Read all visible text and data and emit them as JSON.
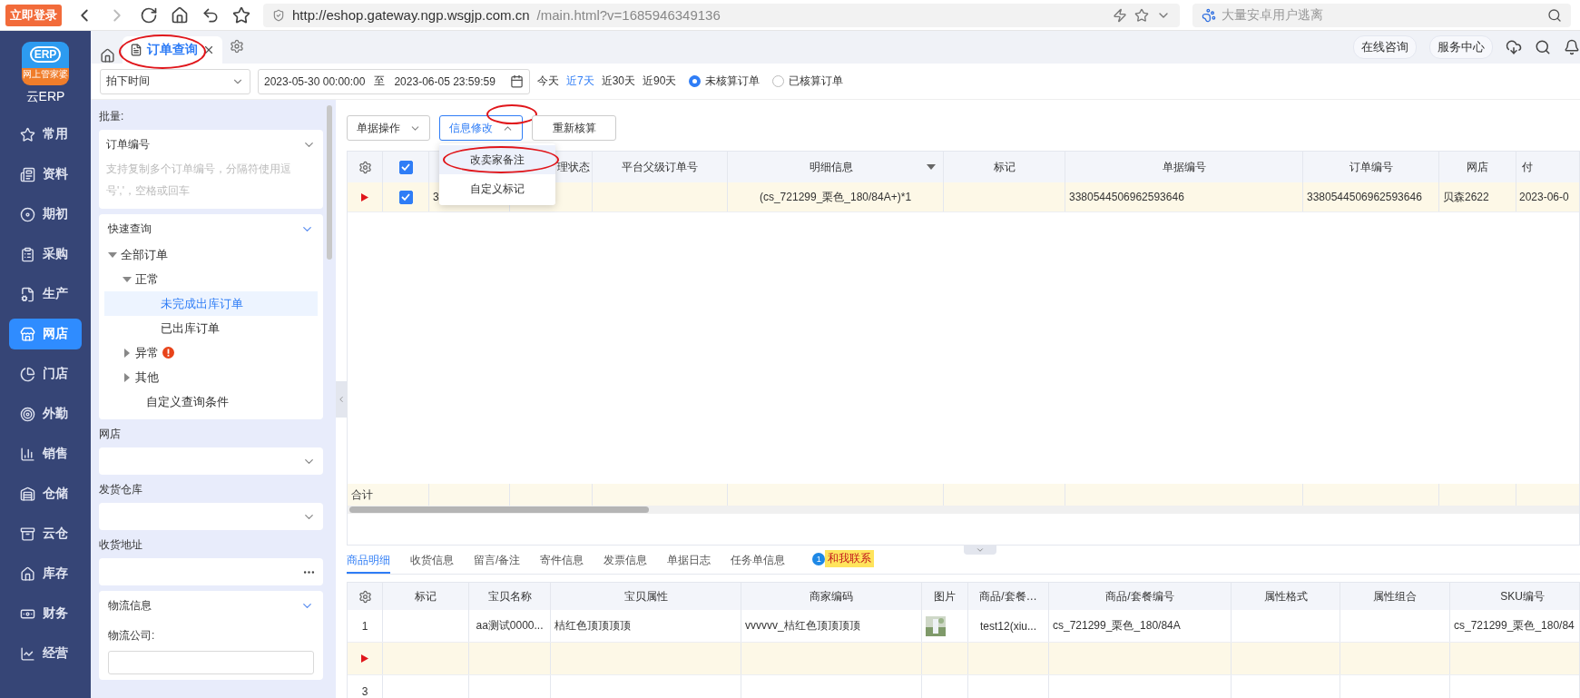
{
  "browser": {
    "login_button": "立即登录",
    "url_host": "http://eshop.gateway.ngp.wsgjp.com.cn",
    "url_path": "/main.html?v=1685946349136",
    "search_placeholder": "大量安卓用户逃离"
  },
  "nav": {
    "logo_mark": "ERP",
    "logo_badge": "网上管家婆",
    "logo_text": "云ERP",
    "items": [
      {
        "label": "常用",
        "selected": false
      },
      {
        "label": "资料",
        "selected": false
      },
      {
        "label": "期初",
        "selected": false
      },
      {
        "label": "采购",
        "selected": false
      },
      {
        "label": "生产",
        "selected": false
      },
      {
        "label": "网店",
        "selected": true
      },
      {
        "label": "门店",
        "selected": false
      },
      {
        "label": "外勤",
        "selected": false
      },
      {
        "label": "销售",
        "selected": false
      },
      {
        "label": "仓储",
        "selected": false
      },
      {
        "label": "云仓",
        "selected": false
      },
      {
        "label": "库存",
        "selected": false
      },
      {
        "label": "财务",
        "selected": false
      },
      {
        "label": "经营",
        "selected": false
      }
    ]
  },
  "tabs": [
    {
      "label": "订单查询",
      "selected": true,
      "circled": true
    }
  ],
  "header_links": [
    "在线咨询",
    "服务中心"
  ],
  "filters": {
    "time_field": "拍下时间",
    "date_from": "2023-05-30 00:00:00",
    "date_sep": "至",
    "date_to": "2023-06-05 23:59:59",
    "quick_ranges": [
      {
        "label": "今天",
        "selected": false
      },
      {
        "label": "近7天",
        "selected": true
      },
      {
        "label": "近30天",
        "selected": false
      },
      {
        "label": "近90天",
        "selected": false
      }
    ],
    "status_options": [
      {
        "label": "未核算订单",
        "selected": true
      },
      {
        "label": "已核算订单",
        "selected": false
      }
    ]
  },
  "side_panel": {
    "batch_label": "批量:",
    "batch_field": "订单编号",
    "batch_placeholder": "支持复制多个订单编号，分隔符使用逗号','，空格或回车",
    "quick_query": {
      "title": "快速查询",
      "tree": [
        {
          "label": "全部订单",
          "expanded": true,
          "selected": false,
          "alert": false,
          "children": [
            {
              "label": "正常",
              "expanded": true,
              "selected": false,
              "alert": false,
              "children": [
                {
                  "label": "未完成出库订单",
                  "selected": true,
                  "alert": false
                },
                {
                  "label": "已出库订单",
                  "selected": false,
                  "alert": false
                }
              ]
            },
            {
              "label": "异常",
              "expanded": false,
              "selected": false,
              "alert": true
            },
            {
              "label": "其他",
              "expanded": false,
              "selected": false,
              "alert": false
            },
            {
              "label": "自定义查询条件",
              "selected": false,
              "alert": false
            }
          ]
        }
      ]
    },
    "fields": [
      {
        "label": "网店",
        "kind": "select"
      },
      {
        "label": "发货仓库",
        "kind": "select"
      },
      {
        "label": "收货地址",
        "kind": "more"
      }
    ],
    "logistics": {
      "title": "物流信息",
      "company_label": "物流公司:"
    }
  },
  "toolbar": [
    {
      "label": "单据操作",
      "kind": "dropdown",
      "open": false,
      "circled": false
    },
    {
      "label": "信息修改",
      "kind": "dropdown",
      "open": true,
      "circled": true
    },
    {
      "label": "重新核算",
      "kind": "button",
      "open": false,
      "circled": false
    }
  ],
  "menu": [
    {
      "label": "改卖家备注",
      "hovered": true,
      "circled": true
    },
    {
      "label": "自定义标记",
      "hovered": false,
      "circled": false
    }
  ],
  "order_table": {
    "header_checked": true,
    "columns": [
      {},
      {
        "label": "理状态"
      },
      {
        "label": "平台父级订单号"
      },
      {
        "label": "明细信息",
        "sortable": true
      },
      {
        "label": "标记"
      },
      {
        "label": "单据编号"
      },
      {
        "label": "订单编号"
      },
      {
        "label": "网店"
      },
      {
        "label": "付"
      }
    ],
    "rows": [
      {
        "current": true,
        "checked": true,
        "cells": [
          "3",
          null,
          null,
          "(cs_721299_栗色_180/84A+)*1",
          null,
          "3380544506962593646",
          "3380544506962593646",
          "贝森2622",
          "2023-06-0"
        ]
      }
    ],
    "total_label": "合计"
  },
  "detail_tabs": [
    {
      "label": "商品明细",
      "selected": true
    },
    {
      "label": "收货信息",
      "selected": false
    },
    {
      "label": "留言/备注",
      "selected": false
    },
    {
      "label": "寄件信息",
      "selected": false
    },
    {
      "label": "发票信息",
      "selected": false
    },
    {
      "label": "单据日志",
      "selected": false
    },
    {
      "label": "任务单信息",
      "selected": false
    }
  ],
  "chat_badge": {
    "count": "1",
    "label": "和我联系"
  },
  "detail_table": {
    "columns": [
      "标记",
      "宝贝名称",
      "宝贝属性",
      "商家编码",
      "图片",
      "商品/套餐…",
      "商品/套餐编号",
      "属性格式",
      "属性组合",
      "SKU编号"
    ],
    "rows": [
      {
        "number": "1",
        "current": false,
        "picture": true,
        "cells": [
          null,
          "aa测试0000...",
          "桔红色顶顶顶顶",
          "vvvvvv_桔红色顶顶顶顶",
          null,
          "test12(xiu...",
          "cs_721299_栗色_180/84A",
          null,
          null,
          "cs_721299_栗色_180/84"
        ]
      },
      {
        "current": true,
        "picture": false,
        "cells": []
      },
      {
        "number": "3",
        "current": false,
        "picture": false,
        "cells": []
      }
    ]
  }
}
